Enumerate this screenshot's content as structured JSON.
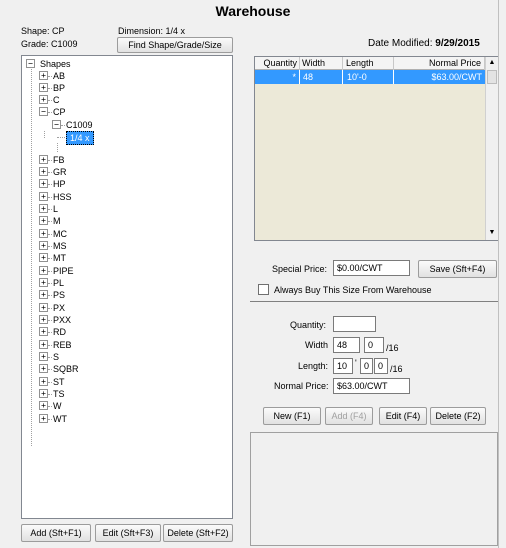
{
  "window": {
    "title": "Warehouse"
  },
  "header": {
    "shape_label": "Shape: CP",
    "dimension_label": "Dimension: 1/4 x",
    "grade_label": "Grade: C1009",
    "find_button": "Find Shape/Grade/Size",
    "date_modified_label": "Date Modified:",
    "date_modified_value": "9/29/2015"
  },
  "tree": {
    "root": {
      "toggle": "−",
      "label": "Shapes"
    },
    "items": [
      {
        "toggle": "+",
        "label": "AB"
      },
      {
        "toggle": "+",
        "label": "BP"
      },
      {
        "toggle": "+",
        "label": "C"
      },
      {
        "toggle": "−",
        "label": "CP"
      },
      {
        "toggle": "−",
        "label": "C1009"
      },
      {
        "toggle": "",
        "label": "1/4 x"
      },
      {
        "toggle": "+",
        "label": "FB"
      },
      {
        "toggle": "+",
        "label": "GR"
      },
      {
        "toggle": "+",
        "label": "HP"
      },
      {
        "toggle": "+",
        "label": "HSS"
      },
      {
        "toggle": "+",
        "label": "L"
      },
      {
        "toggle": "+",
        "label": "M"
      },
      {
        "toggle": "+",
        "label": "MC"
      },
      {
        "toggle": "+",
        "label": "MS"
      },
      {
        "toggle": "+",
        "label": "MT"
      },
      {
        "toggle": "+",
        "label": "PIPE"
      },
      {
        "toggle": "+",
        "label": "PL"
      },
      {
        "toggle": "+",
        "label": "PS"
      },
      {
        "toggle": "+",
        "label": "PX"
      },
      {
        "toggle": "+",
        "label": "PXX"
      },
      {
        "toggle": "+",
        "label": "RD"
      },
      {
        "toggle": "+",
        "label": "REB"
      },
      {
        "toggle": "+",
        "label": "S"
      },
      {
        "toggle": "+",
        "label": "SQBR"
      },
      {
        "toggle": "+",
        "label": "ST"
      },
      {
        "toggle": "+",
        "label": "TS"
      },
      {
        "toggle": "+",
        "label": "W"
      },
      {
        "toggle": "+",
        "label": "WT"
      }
    ]
  },
  "left_buttons": {
    "add": "Add (Sft+F1)",
    "edit": "Edit (Sft+F3)",
    "delete": "Delete (Sft+F2)"
  },
  "grid": {
    "columns": [
      "Quantity",
      "Width",
      "Length",
      "Normal Price"
    ],
    "rows": [
      {
        "quantity": "*",
        "width": "48",
        "length": "10'-0",
        "price": "$63.00/CWT"
      }
    ]
  },
  "special": {
    "label": "Special Price:",
    "value": "$0.00/CWT",
    "save_button": "Save (Sft+F4)",
    "always_buy_label": "Always Buy This Size From Warehouse"
  },
  "form": {
    "quantity_label": "Quantity:",
    "quantity_value": "",
    "width_label": "Width",
    "width_value": "48",
    "width_frac": "0",
    "width_denom": "/16",
    "length_label": "Length:",
    "length_ft": "10",
    "length_in": "0",
    "length_frac": "0",
    "length_denom": "/16",
    "price_label": "Normal Price:",
    "price_value": "$63.00/CWT",
    "foot_mark": "'"
  },
  "right_buttons": {
    "new": "New (F1)",
    "add": "Add (F4)",
    "edit": "Edit (F4)",
    "delete": "Delete (F2)"
  },
  "colors": {
    "selection": "#3399ff",
    "grid_bg": "#ece9d8",
    "window_bg": "#f0f0f0"
  }
}
